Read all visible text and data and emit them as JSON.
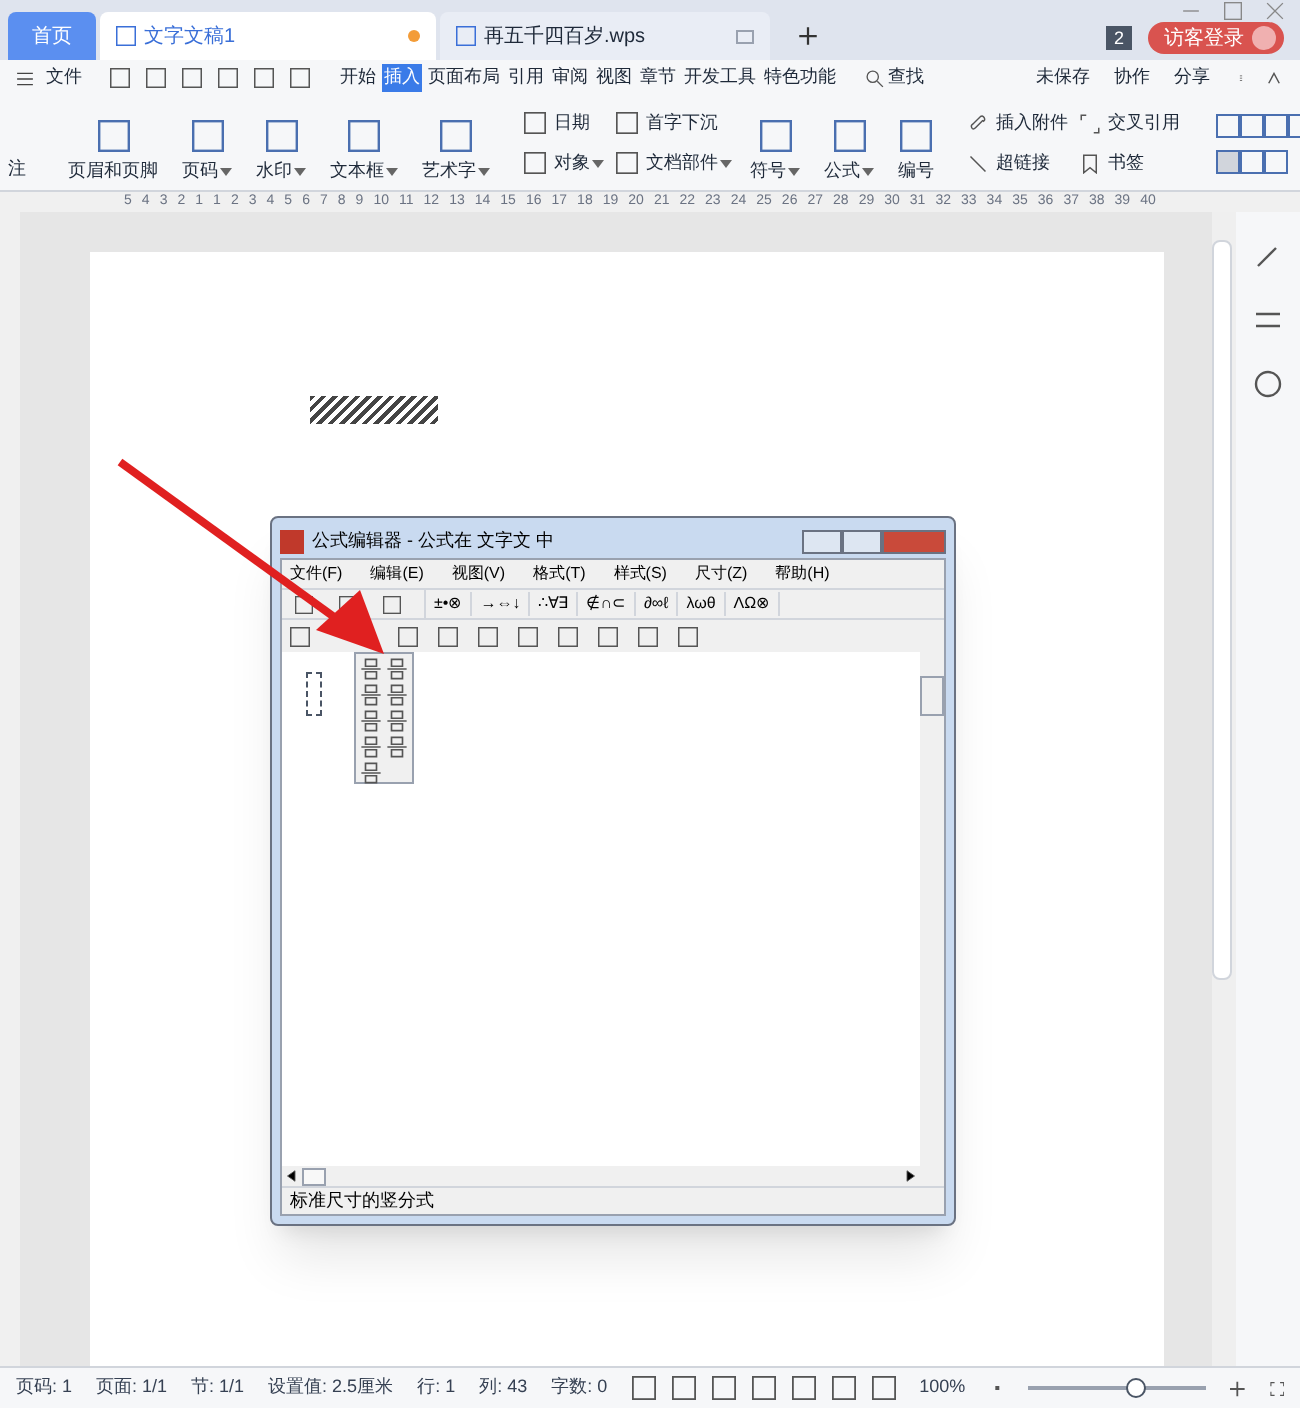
{
  "doc_tabs": [
    {
      "label": "首页",
      "kind": "home",
      "selected": false
    },
    {
      "label": "文字文稿1",
      "kind": "doc",
      "selected": true,
      "modified": true
    },
    {
      "label": "再五千四百岁.wps",
      "kind": "doc",
      "selected": false,
      "modified": false
    }
  ],
  "badge": "2",
  "login": "访客登录",
  "menu": {
    "file": "文件",
    "tabs": [
      {
        "label": "开始",
        "selected": false
      },
      {
        "label": "插入",
        "selected": true
      },
      {
        "label": "页面布局",
        "selected": false
      },
      {
        "label": "引用",
        "selected": false
      },
      {
        "label": "审阅",
        "selected": false
      },
      {
        "label": "视图",
        "selected": false
      },
      {
        "label": "章节",
        "selected": false
      },
      {
        "label": "开发工具",
        "selected": false
      },
      {
        "label": "特色功能",
        "selected": false
      }
    ],
    "search": "查找",
    "actions": [
      "未保存",
      "协作",
      "分享"
    ]
  },
  "ribbon": {
    "left": "注",
    "large": [
      {
        "label": "页眉和页脚",
        "dropdown": false
      },
      {
        "label": "页码",
        "dropdown": true
      },
      {
        "label": "水印",
        "dropdown": true
      },
      {
        "label": "文本框",
        "dropdown": true
      },
      {
        "label": "艺术字",
        "dropdown": true
      }
    ],
    "small1": [
      {
        "label": "日期",
        "dropdown": false
      },
      {
        "label": "对象",
        "dropdown": true
      }
    ],
    "small2": [
      {
        "label": "首字下沉",
        "dropdown": false
      },
      {
        "label": "文档部件",
        "dropdown": true
      }
    ],
    "large2": [
      {
        "label": "符号",
        "dropdown": true
      },
      {
        "label": "公式",
        "dropdown": true
      },
      {
        "label": "编号",
        "dropdown": false
      }
    ],
    "attach": "插入附件",
    "link": "超链接",
    "crossref": "交叉引用",
    "bookmark": "书签"
  },
  "ruler": [
    "5",
    "4",
    "3",
    "2",
    "1",
    "1",
    "2",
    "3",
    "4",
    "5",
    "6",
    "7",
    "8",
    "9",
    "10",
    "11",
    "12",
    "13",
    "14",
    "15",
    "16",
    "17",
    "18",
    "19",
    "20",
    "21",
    "22",
    "23",
    "24",
    "25",
    "26",
    "27",
    "28",
    "29",
    "30",
    "31",
    "32",
    "33",
    "34",
    "35",
    "36",
    "37",
    "38",
    "39",
    "40"
  ],
  "editor": {
    "title": "公式编辑器 - 公式在 文字文 中",
    "menu": [
      "文件(F)",
      "编辑(E)",
      "视图(V)",
      "格式(T)",
      "样式(S)",
      "尺寸(Z)",
      "帮助(H)"
    ],
    "row1": [
      "±•⊗",
      "→⇔↓",
      "∴∀∃",
      "∉∩⊂",
      "∂∞ℓ",
      "λωθ",
      "ΛΩ⊗"
    ],
    "status": "标准尺寸的竖分式"
  },
  "status_bar": {
    "items": [
      "页码: 1",
      "页面: 1/1",
      "节: 1/1",
      "设置值: 2.5厘米",
      "行: 1",
      "列: 43",
      "字数: 0"
    ],
    "zoom": "100%",
    "level": 0.6
  }
}
